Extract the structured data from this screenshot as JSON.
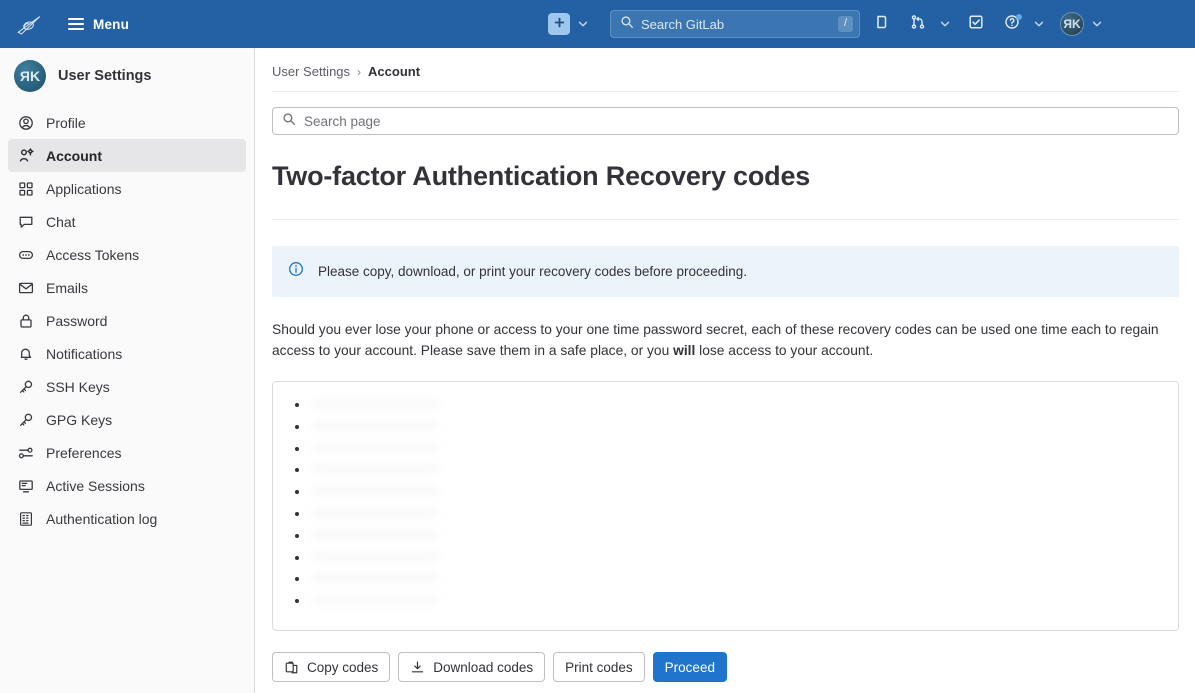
{
  "topnav": {
    "logo_icon": "gitlab-logo",
    "menu_label": "Menu",
    "new_icon": "plus-icon",
    "new_chevron_icon": "chevron-down-icon",
    "search": {
      "placeholder": "Search GitLab",
      "value": "",
      "shortcut": "/",
      "icon": "search-icon"
    },
    "issues_icon": "issues-icon",
    "merge_requests_icon": "merge-request-icon",
    "merge_requests_chevron_icon": "chevron-down-icon",
    "todos_icon": "todo-checkbox-icon",
    "help_icon": "help-question-icon",
    "help_chevron_icon": "chevron-down-icon",
    "avatar_initials": "ЯK",
    "avatar_chevron_icon": "chevron-down-icon"
  },
  "sidebar": {
    "avatar_initials": "ЯK",
    "title": "User Settings",
    "items": [
      {
        "label": "Profile",
        "icon": "user-icon",
        "active": false
      },
      {
        "label": "Account",
        "icon": "user-gear-icon",
        "active": true
      },
      {
        "label": "Applications",
        "icon": "applications-icon",
        "active": false
      },
      {
        "label": "Chat",
        "icon": "comment-icon",
        "active": false
      },
      {
        "label": "Access Tokens",
        "icon": "token-icon",
        "active": false
      },
      {
        "label": "Emails",
        "icon": "envelope-icon",
        "active": false
      },
      {
        "label": "Password",
        "icon": "lock-icon",
        "active": false
      },
      {
        "label": "Notifications",
        "icon": "bell-icon",
        "active": false
      },
      {
        "label": "SSH Keys",
        "icon": "key-icon",
        "active": false
      },
      {
        "label": "GPG Keys",
        "icon": "key-icon",
        "active": false
      },
      {
        "label": "Preferences",
        "icon": "sliders-icon",
        "active": false
      },
      {
        "label": "Active Sessions",
        "icon": "monitor-icon",
        "active": false
      },
      {
        "label": "Authentication log",
        "icon": "log-grid-icon",
        "active": false
      }
    ]
  },
  "breadcrumb": {
    "parent": "User Settings",
    "separator": "›",
    "current": "Account"
  },
  "page_search": {
    "placeholder": "Search page",
    "value": "",
    "icon": "search-icon"
  },
  "page": {
    "title": "Two-factor Authentication Recovery codes",
    "alert": {
      "icon": "info-circle-icon",
      "text": "Please copy, download, or print your recovery codes before proceeding."
    },
    "description_part1": "Should you ever lose your phone or access to your one time password secret, each of these recovery codes can be used one time each to regain access to your account. Please save them in a safe place, or you ",
    "description_emphasis": "will",
    "description_part2": " lose access to your account."
  },
  "recovery_codes": {
    "redacted": true,
    "count": 10,
    "codes": [
      "••••••••••••••••",
      "••••••••••••••••",
      "••••••••••••••••",
      "••••••••••••••••",
      "••••••••••••••••",
      "••••••••••••••••",
      "••••••••••••••••",
      "••••••••••••••••",
      "••••••••••••••••",
      "••••••••••••••••"
    ]
  },
  "actions": {
    "copy": {
      "label": "Copy codes",
      "icon": "clipboard-icon"
    },
    "download": {
      "label": "Download codes",
      "icon": "download-icon"
    },
    "print": {
      "label": "Print codes",
      "icon": ""
    },
    "proceed": {
      "label": "Proceed",
      "icon": ""
    }
  },
  "colors": {
    "nav_background": "#2461a4",
    "accent_blue": "#1f75cb",
    "alert_background": "#ecf4fb",
    "sidebar_background": "#fafafa",
    "active_item_background": "#e6e5e8",
    "text_primary": "#333238"
  }
}
